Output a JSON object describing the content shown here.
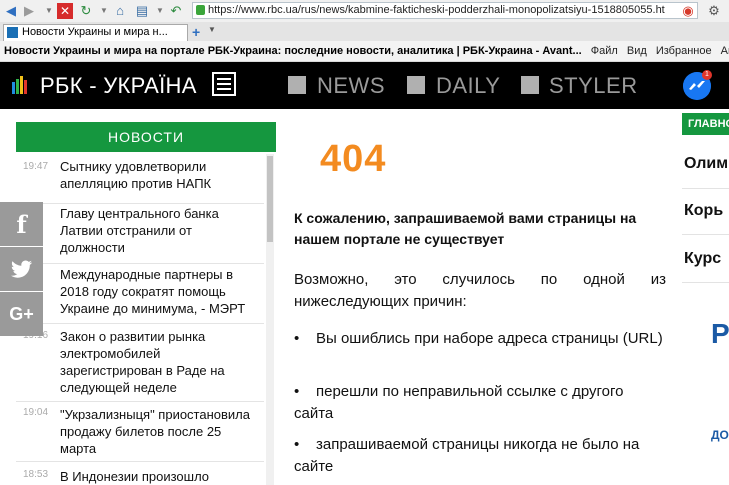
{
  "browser": {
    "url": "https://www.rbc.ua/rus/news/kabmine-fakticheski-podderzhali-monopolizatsiyu-1518805055.ht",
    "tab_title": "Новости Украины и мира н...",
    "window_title": "Новости Украины и мира на портале РБК-Украина: последние новости, аналитика | РБК-Украина - Avant...",
    "menu": [
      "Файл",
      "Вид",
      "Избранное",
      "Автозапо"
    ],
    "new_tab": "+"
  },
  "header": {
    "logo": "РБК - УКРАЇНА",
    "nav": [
      "NEWS",
      "DAILY",
      "STYLER"
    ],
    "messenger_badge": "1"
  },
  "news": {
    "heading": "НОВОСТИ",
    "items": [
      {
        "time": "19:47",
        "text": "Сытнику удовлетворили апелляцию против НАПК"
      },
      {
        "time": "",
        "text": "Главу центрального банка Латвии отстранили от должности"
      },
      {
        "time": "",
        "text": "Международные партнеры в 2018 году сократят помощь Украине до минимума, - МЭРТ"
      },
      {
        "time": "19:16",
        "text": "Закон о развитии рынка электромобилей зарегистрирован в Раде на следующей неделе"
      },
      {
        "time": "19:04",
        "text": "\"Укрзализныця\" приостановила продажу билетов после 25 марта"
      },
      {
        "time": "18:53",
        "text": "В Индонезии произошло"
      }
    ]
  },
  "social": [
    "f",
    "t",
    "G+"
  ],
  "error": {
    "code": "404",
    "sorry": "К сожалению, запрашиваемой вами страницы на нашем портале не существует",
    "possible": "Возможно, это случилось по одной из нижеследующих причин:",
    "reasons": [
      "Вы ошиблись при наборе адреса страницы (URL)",
      "перешли по неправильной ссылке с другого сайта",
      "запрашиваемой страницы никогда не было на сайте"
    ]
  },
  "right": {
    "badge": "ГЛАВНОЕ",
    "items": [
      "Олим",
      "Корь",
      "Курс"
    ],
    "promo_letter": "Р",
    "promo_small": "ДО"
  },
  "colors": {
    "green": "#15973f",
    "orange": "#f38b20",
    "black_header": "#000000",
    "social_gray": "#9a9a9a"
  }
}
